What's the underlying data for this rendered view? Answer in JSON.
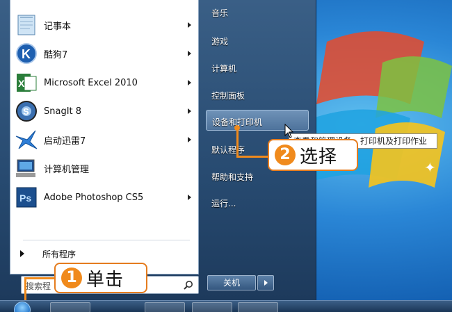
{
  "programs": [
    {
      "label": "记事本",
      "icon": "notepad-icon",
      "has_submenu": true
    },
    {
      "label": "酷狗7",
      "icon": "kugou-icon",
      "has_submenu": true
    },
    {
      "label": "Microsoft Excel 2010",
      "icon": "excel-icon",
      "has_submenu": true
    },
    {
      "label": "SnagIt 8",
      "icon": "snagit-icon",
      "has_submenu": true
    },
    {
      "label": "启动迅雷7",
      "icon": "thunder-icon",
      "has_submenu": true
    },
    {
      "label": "计算机管理",
      "icon": "computer-management-icon",
      "has_submenu": false
    },
    {
      "label": "Adobe Photoshop CS5",
      "icon": "photoshop-icon",
      "has_submenu": true
    }
  ],
  "all_programs": "所有程序",
  "search": {
    "value": "搜索程"
  },
  "right_pane": [
    {
      "label": "音乐"
    },
    {
      "label": "游戏"
    },
    {
      "label": "计算机"
    },
    {
      "label": "控制面板"
    },
    {
      "label": "设备和打印机",
      "highlighted": true
    },
    {
      "label": "默认程序"
    },
    {
      "label": "帮助和支持"
    },
    {
      "label": "运行..."
    }
  ],
  "shutdown": {
    "label": "关机"
  },
  "tooltip": {
    "text": "查看和管理设备、打印机及打印作业"
  },
  "callouts": [
    {
      "num": "1",
      "text": "单击"
    },
    {
      "num": "2",
      "text": "选择"
    }
  ],
  "colors": {
    "accent": "#f08a1c",
    "menu_bg": "#274a70",
    "highlight": "#5d82a9"
  }
}
